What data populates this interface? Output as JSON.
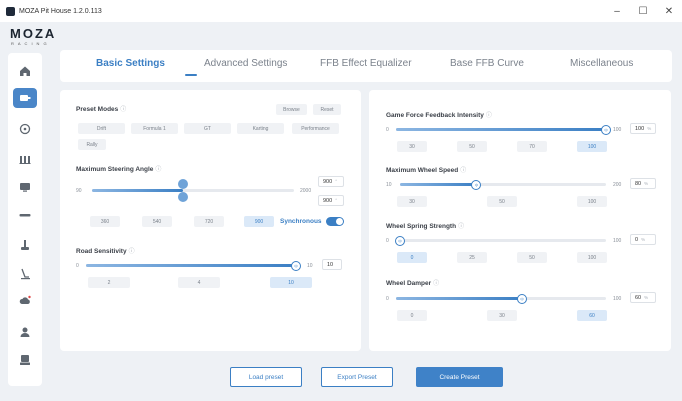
{
  "window": {
    "title": "MOZA Pit House 1.2.0.113",
    "minimize": "–",
    "maximize": "☐",
    "close": "✕"
  },
  "brand": {
    "logo": "MOZA",
    "sub": "RACING"
  },
  "sidebar": {
    "items": [
      {
        "icon": "home-icon"
      },
      {
        "icon": "wheelbase-icon"
      },
      {
        "icon": "steering-wheel-icon"
      },
      {
        "icon": "pedals-icon"
      },
      {
        "icon": "dashboard-icon"
      },
      {
        "icon": "wheel-display-icon"
      },
      {
        "icon": "handbrake-icon"
      },
      {
        "icon": "shifter-icon"
      },
      {
        "icon": "cloud-icon"
      },
      {
        "icon": "user-icon"
      },
      {
        "icon": "settings-icon"
      }
    ],
    "active_index": 1
  },
  "tabs": [
    {
      "label": "Basic Settings",
      "active": true
    },
    {
      "label": "Advanced Settings",
      "active": false
    },
    {
      "label": "FFB Effect Equalizer",
      "active": false
    },
    {
      "label": "Base FFB Curve",
      "active": false
    },
    {
      "label": "Miscellaneous",
      "active": false
    }
  ],
  "left": {
    "preset_modes": {
      "label": "Preset Modes",
      "browse": "Browse",
      "reset": "Reset",
      "options": [
        "Drift",
        "Formula 1",
        "GT",
        "Karting",
        "Performance",
        "Rally"
      ]
    },
    "steering_angle": {
      "label": "Maximum Steering Angle",
      "min": "90",
      "max": "2000",
      "value_top": "900",
      "value_bottom": "900",
      "unit": "°",
      "level_percent": 45,
      "presets": [
        "360",
        "540",
        "720",
        "900"
      ],
      "selected": "900",
      "synchronous_label": "Synchronous",
      "synchronous_on": true
    },
    "road_sensitivity": {
      "label": "Road Sensitivity",
      "min": "0",
      "max": "10",
      "value": "10",
      "level_percent": 100,
      "presets": [
        "2",
        "4",
        "10"
      ],
      "selected": "10"
    }
  },
  "right": {
    "game_ffb": {
      "label": "Game Force Feedback Intensity",
      "min": "0",
      "max": "100",
      "value": "100",
      "unit": "%",
      "level_percent": 100,
      "presets": [
        "30",
        "50",
        "70",
        "100"
      ],
      "selected": "100"
    },
    "wheel_speed": {
      "label": "Maximum Wheel Speed",
      "min": "10",
      "max": "200",
      "value": "80",
      "unit": "%",
      "level_percent": 37,
      "presets": [
        "30",
        "50",
        "100"
      ],
      "selected": ""
    },
    "spring": {
      "label": "Wheel Spring Strength",
      "min": "0",
      "max": "100",
      "value": "0",
      "unit": "%",
      "level_percent": 0,
      "presets": [
        "0",
        "25",
        "50",
        "100"
      ],
      "selected": "0"
    },
    "damper": {
      "label": "Wheel Damper",
      "min": "0",
      "max": "100",
      "value": "60",
      "unit": "%",
      "level_percent": 60,
      "presets": [
        "0",
        "30",
        "60"
      ],
      "selected": "60"
    }
  },
  "footer": {
    "load": "Load preset",
    "export": "Export Preset",
    "create": "Create Preset"
  },
  "colors": {
    "accent": "#3b7fc4",
    "active_sidebar": "#4a86c8",
    "background": "#eef1f5"
  }
}
